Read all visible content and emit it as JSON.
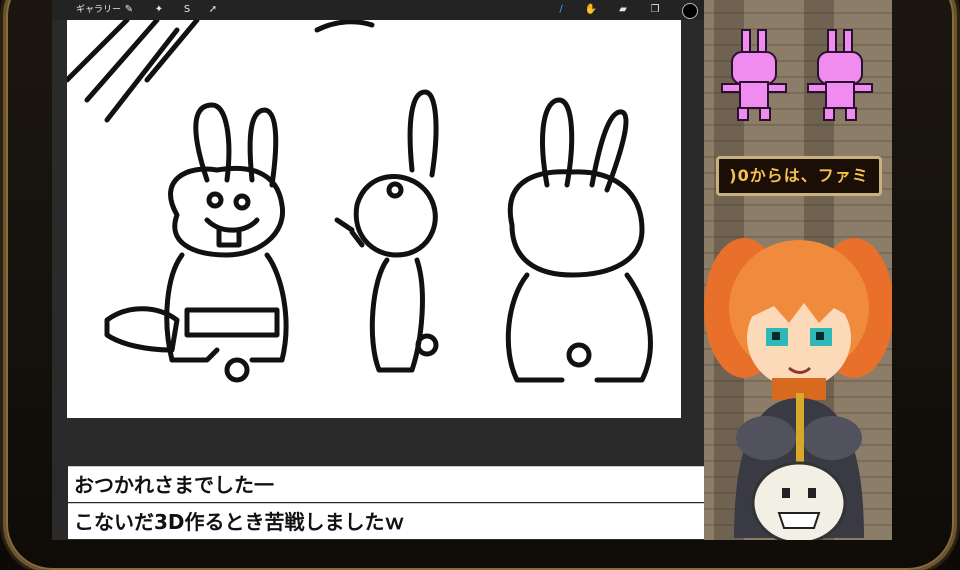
{
  "app": {
    "gallery_label": "ギャラリー",
    "toolbar_icons": [
      "wrench-icon",
      "magic-icon",
      "selection-icon",
      "transform-icon"
    ],
    "brush_icons": [
      "brush-icon",
      "smudge-icon",
      "eraser-icon",
      "layers-icon"
    ],
    "current_color": "#000000"
  },
  "chat": {
    "messages": [
      {
        "text": "おつかれさまでした一"
      },
      {
        "text": "こないだ3D作るとき苦戦しましたｗ"
      }
    ]
  },
  "game": {
    "banner_text": ")0からは、ファミ",
    "accent_color": "#f5c24a",
    "sprite_color": "#f08cf0"
  }
}
